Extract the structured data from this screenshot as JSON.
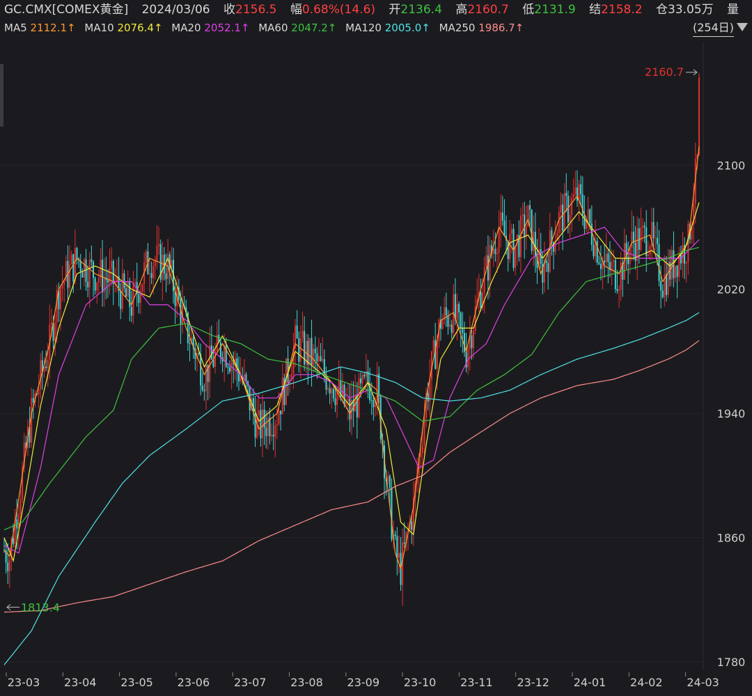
{
  "header": {
    "symbol": "GC.CMX[COMEX黄金]",
    "date": "2024/03/06",
    "close_label": "收",
    "close_value": "2156.5",
    "change_label": "幅",
    "change_value": "0.68%(14.6)",
    "open_label": "开",
    "open_value": "2136.4",
    "high_label": "高",
    "high_value": "2160.7",
    "low_label": "低",
    "low_value": "2131.9",
    "settle_label": "结",
    "settle_value": "2158.2",
    "oi_label": "仓",
    "oi_value": "33.05万",
    "volume_label": "量"
  },
  "ma_legend": [
    {
      "name": "MA5",
      "value": "2112.1↑",
      "color": "#ff9a2e"
    },
    {
      "name": "MA10",
      "value": "2076.4↑",
      "color": "#f2ea3a"
    },
    {
      "name": "MA20",
      "value": "2052.1↑",
      "color": "#e040e8"
    },
    {
      "name": "MA60",
      "value": "2047.2↑",
      "color": "#3ec23e"
    },
    {
      "name": "MA120",
      "value": "2005.0↑",
      "color": "#4fe3e8"
    },
    {
      "name": "MA250",
      "value": "1986.7↑",
      "color": "#ff8c8c"
    }
  ],
  "days_label": "(254日)",
  "colors": {
    "up": "#e03030",
    "down": "#42d6d6",
    "ma5": "#ff9a2e",
    "ma10": "#f2ea3a",
    "ma20": "#e040e8",
    "ma60": "#3ec23e",
    "ma120": "#4fe3e8",
    "ma250": "#ff8c8c",
    "high_mark": "#e03030",
    "low_mark": "#3ec23e"
  },
  "chart_data": {
    "type": "line",
    "ylim": [
      1775,
      2175
    ],
    "y_ticks": [
      1780,
      1860,
      1940,
      2020,
      2100
    ],
    "x_tick_labels": [
      "23-03",
      "23-04",
      "23-05",
      "23-06",
      "23-07",
      "23-08",
      "23-09",
      "23-10",
      "23-11",
      "23-12",
      "24-01",
      "24-02",
      "24-03"
    ],
    "high_marker": {
      "value": 2160.7,
      "label": "2160.7"
    },
    "low_marker": {
      "value": 1813.4,
      "label": "1813.4"
    },
    "series": [
      {
        "name": "MA5",
        "points": [
          [
            0,
            1852
          ],
          [
            3,
            1848
          ],
          [
            8,
            1885
          ],
          [
            15,
            1940
          ],
          [
            25,
            1985
          ],
          [
            30,
            2020
          ],
          [
            40,
            2040
          ],
          [
            50,
            2030
          ],
          [
            60,
            2025
          ],
          [
            70,
            2010
          ],
          [
            80,
            2040
          ],
          [
            90,
            2035
          ],
          [
            100,
            1995
          ],
          [
            110,
            1965
          ],
          [
            120,
            1985
          ],
          [
            130,
            1965
          ],
          [
            140,
            1930
          ],
          [
            150,
            1940
          ],
          [
            160,
            1985
          ],
          [
            170,
            1975
          ],
          [
            180,
            1960
          ],
          [
            190,
            1940
          ],
          [
            200,
            1960
          ],
          [
            205,
            1955
          ],
          [
            210,
            1900
          ],
          [
            215,
            1850
          ],
          [
            218,
            1840
          ],
          [
            225,
            1880
          ],
          [
            232,
            1950
          ],
          [
            240,
            2000
          ],
          [
            247,
            2005
          ],
          [
            254,
            1980
          ],
          [
            262,
            2020
          ],
          [
            272,
            2060
          ],
          [
            280,
            2045
          ],
          [
            288,
            2065
          ],
          [
            295,
            2030
          ],
          [
            305,
            2065
          ],
          [
            315,
            2080
          ],
          [
            322,
            2060
          ],
          [
            330,
            2035
          ],
          [
            338,
            2030
          ],
          [
            345,
            2050
          ],
          [
            355,
            2055
          ],
          [
            362,
            2025
          ],
          [
            370,
            2040
          ],
          [
            376,
            2050
          ],
          [
            382,
            2112
          ]
        ]
      },
      {
        "name": "MA10",
        "points": [
          [
            0,
            1860
          ],
          [
            5,
            1845
          ],
          [
            12,
            1890
          ],
          [
            20,
            1945
          ],
          [
            30,
            1995
          ],
          [
            40,
            2030
          ],
          [
            50,
            2035
          ],
          [
            60,
            2030
          ],
          [
            70,
            2020
          ],
          [
            80,
            2015
          ],
          [
            90,
            2040
          ],
          [
            100,
            2005
          ],
          [
            110,
            1970
          ],
          [
            120,
            1990
          ],
          [
            130,
            1965
          ],
          [
            140,
            1935
          ],
          [
            150,
            1945
          ],
          [
            160,
            1980
          ],
          [
            170,
            1970
          ],
          [
            180,
            1960
          ],
          [
            190,
            1945
          ],
          [
            200,
            1960
          ],
          [
            210,
            1930
          ],
          [
            218,
            1870
          ],
          [
            225,
            1862
          ],
          [
            232,
            1920
          ],
          [
            240,
            1975
          ],
          [
            250,
            1995
          ],
          [
            258,
            1995
          ],
          [
            268,
            2025
          ],
          [
            278,
            2050
          ],
          [
            288,
            2055
          ],
          [
            296,
            2040
          ],
          [
            306,
            2055
          ],
          [
            316,
            2070
          ],
          [
            326,
            2055
          ],
          [
            336,
            2040
          ],
          [
            346,
            2040
          ],
          [
            356,
            2045
          ],
          [
            366,
            2035
          ],
          [
            374,
            2045
          ],
          [
            382,
            2076
          ]
        ]
      },
      {
        "name": "MA20",
        "points": [
          [
            0,
            1855
          ],
          [
            8,
            1850
          ],
          [
            20,
            1905
          ],
          [
            30,
            1965
          ],
          [
            45,
            2010
          ],
          [
            60,
            2025
          ],
          [
            70,
            2025
          ],
          [
            80,
            2010
          ],
          [
            90,
            2010
          ],
          [
            100,
            2000
          ],
          [
            110,
            1985
          ],
          [
            120,
            1975
          ],
          [
            130,
            1965
          ],
          [
            140,
            1950
          ],
          [
            150,
            1950
          ],
          [
            160,
            1965
          ],
          [
            170,
            1965
          ],
          [
            180,
            1960
          ],
          [
            190,
            1950
          ],
          [
            200,
            1955
          ],
          [
            210,
            1950
          ],
          [
            218,
            1930
          ],
          [
            228,
            1905
          ],
          [
            236,
            1910
          ],
          [
            245,
            1950
          ],
          [
            255,
            1975
          ],
          [
            265,
            1985
          ],
          [
            275,
            2010
          ],
          [
            290,
            2040
          ],
          [
            305,
            2050
          ],
          [
            318,
            2055
          ],
          [
            330,
            2060
          ],
          [
            340,
            2045
          ],
          [
            350,
            2040
          ],
          [
            362,
            2040
          ],
          [
            372,
            2040
          ],
          [
            382,
            2052
          ]
        ]
      },
      {
        "name": "MA60",
        "points": [
          [
            0,
            1865
          ],
          [
            10,
            1870
          ],
          [
            25,
            1895
          ],
          [
            45,
            1925
          ],
          [
            60,
            1942
          ],
          [
            70,
            1975
          ],
          [
            85,
            1995
          ],
          [
            100,
            1998
          ],
          [
            115,
            1990
          ],
          [
            130,
            1985
          ],
          [
            145,
            1975
          ],
          [
            160,
            1972
          ],
          [
            180,
            1963
          ],
          [
            200,
            1955
          ],
          [
            215,
            1948
          ],
          [
            230,
            1935
          ],
          [
            245,
            1938
          ],
          [
            260,
            1955
          ],
          [
            275,
            1965
          ],
          [
            290,
            1978
          ],
          [
            305,
            2005
          ],
          [
            320,
            2025
          ],
          [
            335,
            2030
          ],
          [
            350,
            2035
          ],
          [
            365,
            2040
          ],
          [
            375,
            2045
          ],
          [
            382,
            2047
          ]
        ]
      },
      {
        "name": "MA120",
        "points": [
          [
            0,
            1778
          ],
          [
            15,
            1800
          ],
          [
            30,
            1835
          ],
          [
            50,
            1870
          ],
          [
            65,
            1895
          ],
          [
            80,
            1913
          ],
          [
            100,
            1930
          ],
          [
            120,
            1948
          ],
          [
            140,
            1953
          ],
          [
            160,
            1960
          ],
          [
            185,
            1970
          ],
          [
            200,
            1966
          ],
          [
            215,
            1960
          ],
          [
            230,
            1950
          ],
          [
            245,
            1948
          ],
          [
            262,
            1950
          ],
          [
            278,
            1955
          ],
          [
            295,
            1965
          ],
          [
            315,
            1975
          ],
          [
            335,
            1982
          ],
          [
            350,
            1988
          ],
          [
            365,
            1995
          ],
          [
            375,
            2000
          ],
          [
            382,
            2005
          ]
        ]
      },
      {
        "name": "MA250",
        "points": [
          [
            0,
            1812
          ],
          [
            20,
            1813
          ],
          [
            40,
            1818
          ],
          [
            60,
            1822
          ],
          [
            80,
            1830
          ],
          [
            100,
            1838
          ],
          [
            120,
            1845
          ],
          [
            140,
            1858
          ],
          [
            160,
            1868
          ],
          [
            180,
            1878
          ],
          [
            200,
            1883
          ],
          [
            215,
            1893
          ],
          [
            230,
            1900
          ],
          [
            245,
            1915
          ],
          [
            262,
            1928
          ],
          [
            278,
            1940
          ],
          [
            295,
            1950
          ],
          [
            315,
            1958
          ],
          [
            335,
            1962
          ],
          [
            350,
            1968
          ],
          [
            365,
            1975
          ],
          [
            375,
            1981
          ],
          [
            382,
            1987
          ]
        ]
      }
    ]
  }
}
